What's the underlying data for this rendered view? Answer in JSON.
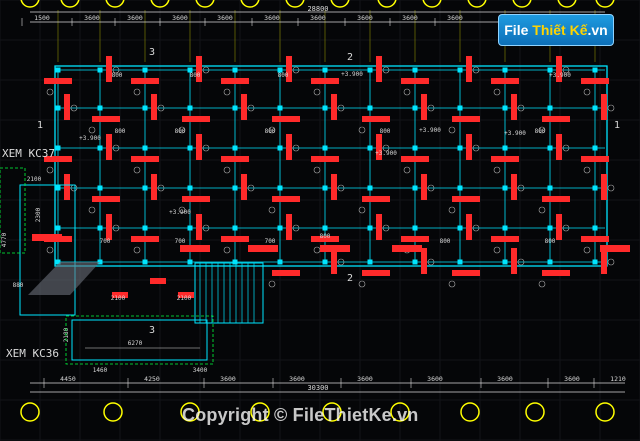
{
  "drawing": {
    "top_dims": [
      "1500",
      "3600",
      "3600",
      "3600",
      "3600",
      "3600",
      "3600",
      "3600",
      "3600",
      "3600"
    ],
    "top_total": "28800",
    "bottom_dims": [
      "4450",
      "4250",
      "3600",
      "3600",
      "3600",
      "3600",
      "3600",
      "3600",
      "1210"
    ],
    "bottom_total": "30300",
    "sub_dims": [
      "1460",
      "6270",
      "3400"
    ],
    "side_dims": [
      "2100",
      "2300",
      "4770",
      "880",
      "2180"
    ],
    "section_labels": [
      "3",
      "2",
      "1",
      "1",
      "2",
      "3"
    ],
    "refs": {
      "kc37": "XEM KC37",
      "kc36": "XEM KC36"
    },
    "levels": [
      "+3.900",
      "+3.900",
      "+3.900",
      "+3.900",
      "+3.900",
      "+3.900",
      "+3.900"
    ],
    "beam_tags": [
      "800",
      "800",
      "800",
      "800",
      "800",
      "800",
      "800",
      "800",
      "700",
      "700",
      "700",
      "800",
      "800",
      "800"
    ]
  },
  "watermark": {
    "pre": "File",
    "mid": "Thiết Kế",
    "suf": ".vn",
    "copyright": "Copyright © FileThietKe.vn"
  },
  "colors": {
    "grid": "#00e5ff",
    "column": "#ff2a2a",
    "dim": "#d9d9d9",
    "yellow": "#ffff00",
    "green": "#00ff3c"
  }
}
